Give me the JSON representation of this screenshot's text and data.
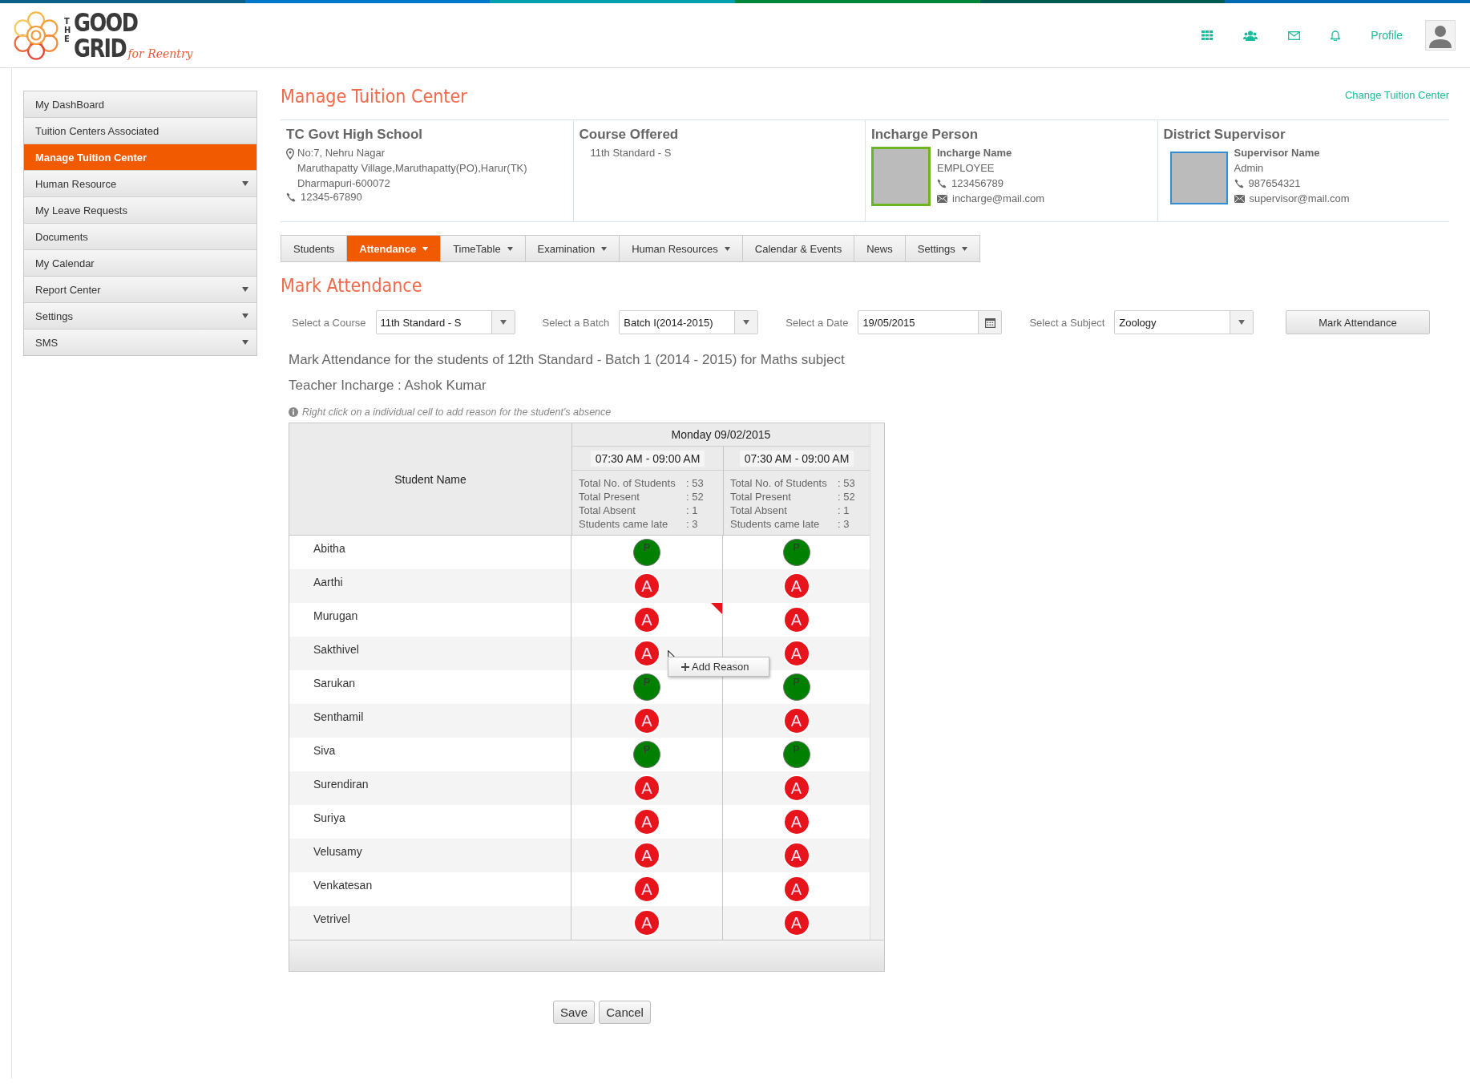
{
  "header": {
    "logo": {
      "word_the": "THE",
      "word_good": "GOOD",
      "word_grid": "GRID",
      "tagline": "for Reentry"
    },
    "profile_label": "Profile"
  },
  "sidebar": {
    "items": [
      {
        "label": "My DashBoard",
        "selected": false,
        "has_submenu": false
      },
      {
        "label": "Tuition Centers Associated",
        "selected": false,
        "has_submenu": false
      },
      {
        "label": "Manage Tuition Center",
        "selected": true,
        "has_submenu": false
      },
      {
        "label": "Human Resource",
        "selected": false,
        "has_submenu": true
      },
      {
        "label": "My Leave Requests",
        "selected": false,
        "has_submenu": false
      },
      {
        "label": "Documents",
        "selected": false,
        "has_submenu": false
      },
      {
        "label": "My Calendar",
        "selected": false,
        "has_submenu": false
      },
      {
        "label": "Report Center",
        "selected": false,
        "has_submenu": true
      },
      {
        "label": "Settings",
        "selected": false,
        "has_submenu": true
      },
      {
        "label": "SMS",
        "selected": false,
        "has_submenu": true
      }
    ]
  },
  "page_title": "Manage Tuition Center",
  "change_link": "Change Tuition Center",
  "info": {
    "center": {
      "title": "TC Govt High School",
      "address_lines": [
        "No:7, Nehru Nagar",
        "Maruthapatty Village,Maruthapatty(PO),Harur(TK)",
        "Dharmapuri-600072"
      ],
      "phone": "12345-67890"
    },
    "course": {
      "title": "Course Offered",
      "value": "11th Standard - S"
    },
    "incharge": {
      "title": "Incharge Person",
      "name": "Incharge Name",
      "role": "EMPLOYEE",
      "phone": "123456789",
      "email": "incharge@mail.com"
    },
    "supervisor": {
      "title": "District Supervisor",
      "name": "Supervisor Name",
      "role": "Admin",
      "phone": "987654321",
      "email": "supervisor@mail.com"
    }
  },
  "tabs": [
    {
      "label": "Students",
      "selected": false,
      "has_menu": false
    },
    {
      "label": "Attendance",
      "selected": true,
      "has_menu": true
    },
    {
      "label": "TimeTable",
      "selected": false,
      "has_menu": true
    },
    {
      "label": "Examination",
      "selected": false,
      "has_menu": true
    },
    {
      "label": "Human Resources",
      "selected": false,
      "has_menu": true
    },
    {
      "label": "Calendar & Events",
      "selected": false,
      "has_menu": false
    },
    {
      "label": "News",
      "selected": false,
      "has_menu": false
    },
    {
      "label": "Settings",
      "selected": false,
      "has_menu": true
    }
  ],
  "section_title": "Mark Attendance",
  "filters": [
    {
      "label": "Select a Course",
      "value": "11th Standard - S",
      "kind": "select"
    },
    {
      "label": "Select a Batch",
      "value": "Batch I(2014-2015)",
      "kind": "select"
    },
    {
      "label": "Select a Date",
      "value": "19/05/2015",
      "kind": "date"
    },
    {
      "label": "Select a Subject",
      "value": "Zoology",
      "kind": "select"
    }
  ],
  "mark_button": "Mark Attendance",
  "summary": "Mark Attendance for the students of 12th Standard - Batch 1 (2014 - 2015) for Maths subject",
  "teacher": "Teacher Incharge : Ashok Kumar",
  "hint": "Right click on a individual cell to add reason for the student's absence",
  "table": {
    "name_header": "Student Name",
    "date": "Monday 09/02/2015",
    "sessions": [
      {
        "time": "07:30 AM - 09:00 AM",
        "stats": [
          {
            "label": "Total No. of Students",
            "value": ": 53"
          },
          {
            "label": "Total Present",
            "value": ": 52"
          },
          {
            "label": "Total Absent",
            "value": ": 1"
          },
          {
            "label": "Students came late",
            "value": ": 3"
          }
        ]
      },
      {
        "time": "07:30 AM - 09:00 AM",
        "stats": [
          {
            "label": "Total No. of Students",
            "value": ": 53"
          },
          {
            "label": "Total Present",
            "value": ": 52"
          },
          {
            "label": "Total Absent",
            "value": ": 1"
          },
          {
            "label": "Students came late",
            "value": ": 3"
          }
        ]
      }
    ],
    "rows": [
      {
        "name": "Abitha",
        "cells": [
          {
            "kind": "present",
            "mark": "P",
            "flagged": false
          },
          {
            "kind": "present",
            "mark": "P",
            "flagged": false
          }
        ]
      },
      {
        "name": "Aarthi",
        "cells": [
          {
            "kind": "absent",
            "mark": "A",
            "flagged": false
          },
          {
            "kind": "absent",
            "mark": "A",
            "flagged": false
          }
        ]
      },
      {
        "name": "Murugan",
        "cells": [
          {
            "kind": "absent",
            "mark": "A",
            "flagged": true
          },
          {
            "kind": "absent",
            "mark": "A",
            "flagged": false
          }
        ]
      },
      {
        "name": "Sakthivel",
        "cells": [
          {
            "kind": "absent",
            "mark": "A",
            "flagged": false,
            "menu": "Add Reason"
          },
          {
            "kind": "absent",
            "mark": "A",
            "flagged": false
          }
        ]
      },
      {
        "name": "Sarukan",
        "cells": [
          {
            "kind": "present",
            "mark": "P",
            "flagged": false
          },
          {
            "kind": "present",
            "mark": "P",
            "flagged": false
          }
        ]
      },
      {
        "name": "Senthamil",
        "cells": [
          {
            "kind": "absent",
            "mark": "A",
            "flagged": false
          },
          {
            "kind": "absent",
            "mark": "A",
            "flagged": false
          }
        ]
      },
      {
        "name": "Siva",
        "cells": [
          {
            "kind": "present",
            "mark": "P",
            "flagged": false
          },
          {
            "kind": "present",
            "mark": "P",
            "flagged": false
          }
        ]
      },
      {
        "name": "Surendiran",
        "cells": [
          {
            "kind": "absent",
            "mark": "A",
            "flagged": false
          },
          {
            "kind": "absent",
            "mark": "A",
            "flagged": false
          }
        ]
      },
      {
        "name": "Suriya",
        "cells": [
          {
            "kind": "absent",
            "mark": "A",
            "flagged": false
          },
          {
            "kind": "absent",
            "mark": "A",
            "flagged": false
          }
        ]
      },
      {
        "name": "Velusamy",
        "cells": [
          {
            "kind": "absent",
            "mark": "A",
            "flagged": false
          },
          {
            "kind": "absent",
            "mark": "A",
            "flagged": false
          }
        ]
      },
      {
        "name": "Venkatesan",
        "cells": [
          {
            "kind": "absent",
            "mark": "A",
            "flagged": false
          },
          {
            "kind": "absent",
            "mark": "A",
            "flagged": false
          }
        ]
      },
      {
        "name": "Vetrivel",
        "cells": [
          {
            "kind": "absent",
            "mark": "A",
            "flagged": false
          },
          {
            "kind": "absent",
            "mark": "A",
            "flagged": false
          }
        ]
      }
    ]
  },
  "buttons": [
    {
      "label": "Save"
    },
    {
      "label": "Cancel"
    }
  ]
}
